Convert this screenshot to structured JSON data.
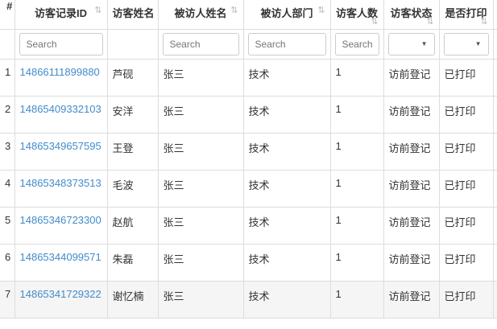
{
  "columns": [
    {
      "label": "#",
      "sortable": false
    },
    {
      "label": "访客记录ID",
      "sortable": true
    },
    {
      "label": "访客姓名",
      "sortable": false
    },
    {
      "label": "被访人姓名",
      "sortable": true
    },
    {
      "label": "被访人部门",
      "sortable": true
    },
    {
      "label": "访客人数",
      "sortable": true
    },
    {
      "label": "访客状态",
      "sortable": true
    },
    {
      "label": "是否打印",
      "sortable": true
    }
  ],
  "filters": {
    "placeholder": "Search",
    "select_arrow": "▼"
  },
  "sort_icon": "⇅",
  "rows": [
    {
      "n": "1",
      "id": "14866111899880",
      "name": "芦砚",
      "host": "张三",
      "dept": "技术",
      "count": "1",
      "status": "访前登记",
      "printed": "已打印"
    },
    {
      "n": "2",
      "id": "14865409332103",
      "name": "安洋",
      "host": "张三",
      "dept": "技术",
      "count": "1",
      "status": "访前登记",
      "printed": "已打印"
    },
    {
      "n": "3",
      "id": "14865349657595",
      "name": "王登",
      "host": "张三",
      "dept": "技术",
      "count": "1",
      "status": "访前登记",
      "printed": "已打印"
    },
    {
      "n": "4",
      "id": "14865348373513",
      "name": "毛波",
      "host": "张三",
      "dept": "技术",
      "count": "1",
      "status": "访前登记",
      "printed": "已打印"
    },
    {
      "n": "5",
      "id": "14865346723300",
      "name": "赵航",
      "host": "张三",
      "dept": "技术",
      "count": "1",
      "status": "访前登记",
      "printed": "已打印"
    },
    {
      "n": "6",
      "id": "14865344099571",
      "name": "朱磊",
      "host": "张三",
      "dept": "技术",
      "count": "1",
      "status": "访前登记",
      "printed": "已打印"
    },
    {
      "n": "7",
      "id": "14865341729322",
      "name": "谢忆楠",
      "host": "张三",
      "dept": "技术",
      "count": "1",
      "status": "访前登记",
      "printed": "已打印"
    }
  ],
  "colors": {
    "link": "#428bca",
    "action": "#e8a33a"
  }
}
